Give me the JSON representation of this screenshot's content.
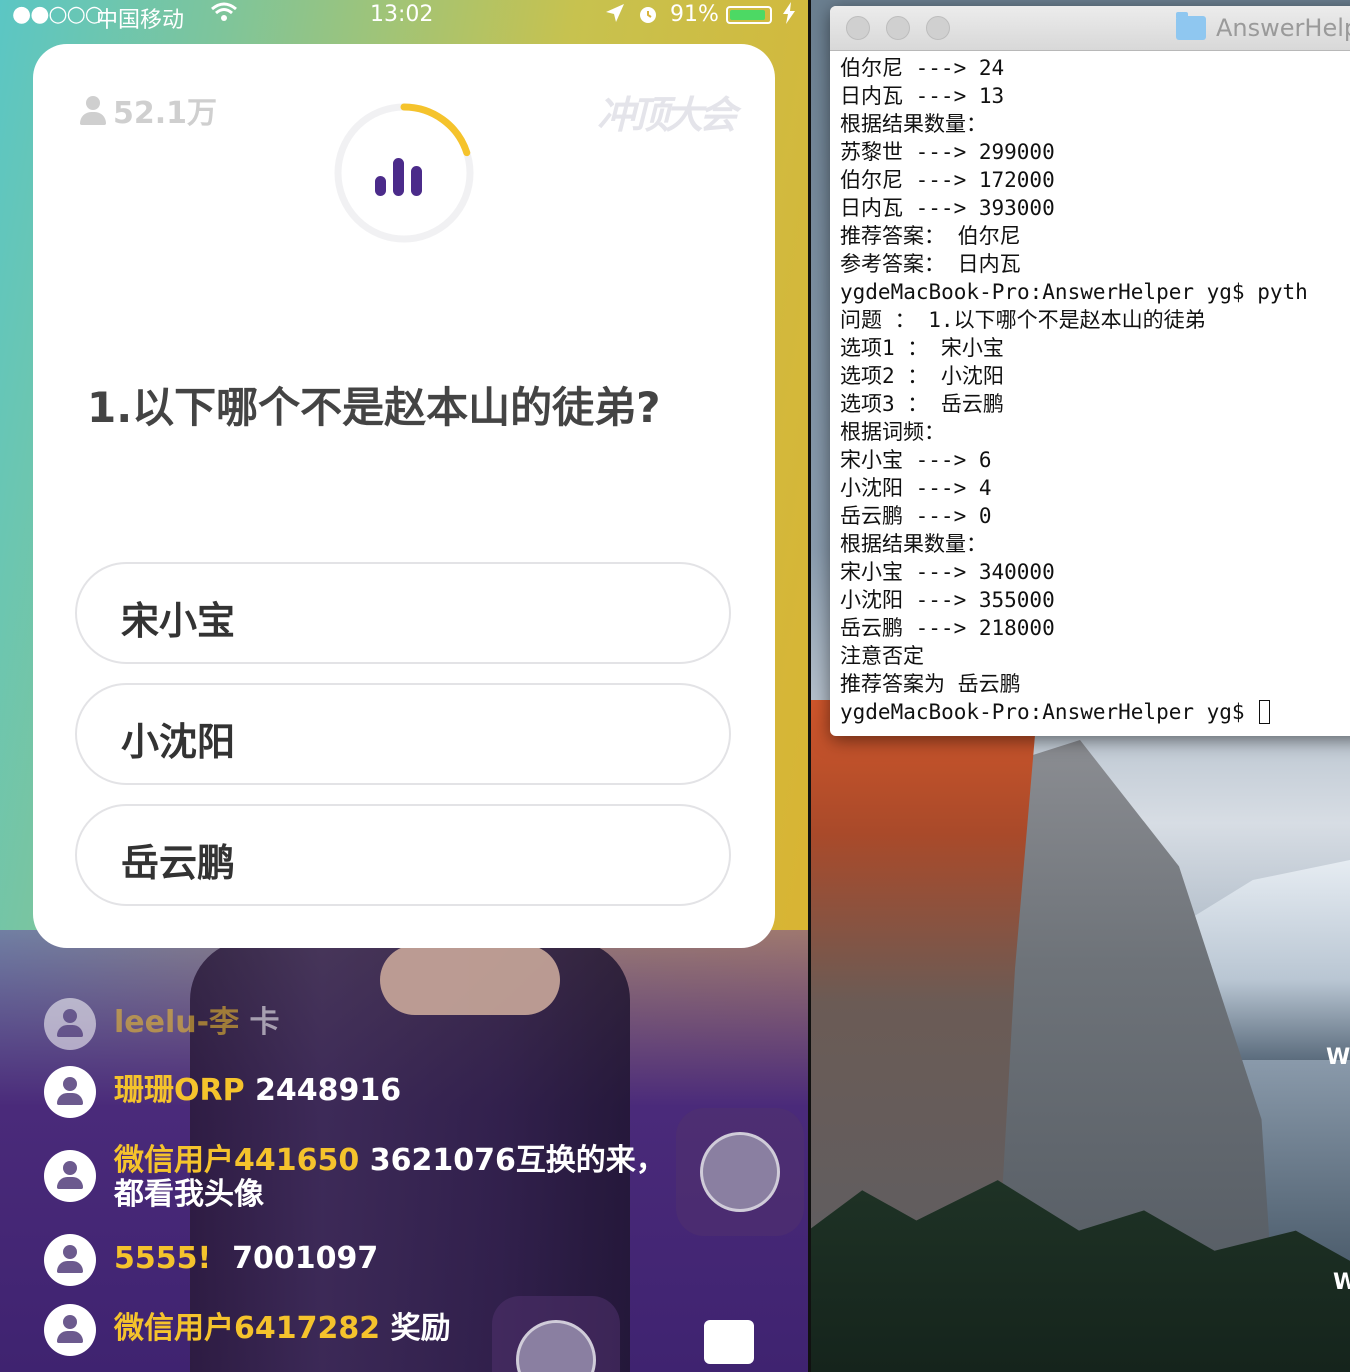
{
  "status_bar": {
    "signal": "●●○○○",
    "carrier": "中国移动",
    "wifi_icon": "wifi-icon",
    "time": "13:02",
    "location_icon": "location-arrow-icon",
    "alarm_icon": "alarm-icon",
    "battery_percent": "91%",
    "battery_level": 0.91,
    "charging_icon": "bolt-icon"
  },
  "quiz": {
    "viewer_count": "52.1万",
    "brand_logo": "冲顶大会",
    "timer_progress": 0.2,
    "question": "1.以下哪个不是赵本山的徒弟?",
    "options": [
      "宋小宝",
      "小沈阳",
      "岳云鹏"
    ]
  },
  "chat": [
    {
      "user": "leelu-李",
      "message": "卡"
    },
    {
      "user": "珊珊ORP",
      "message": " 2448916"
    },
    {
      "user": "微信用户441650",
      "message": " 3621076互换的来，都看我头像"
    },
    {
      "user": "5555!",
      "message": "  7001097"
    },
    {
      "user": "微信用户6417282",
      "message": " 奖励"
    }
  ],
  "terminal": {
    "title": "AnswerHelper",
    "lines": [
      "伯尔尼 ---> 24",
      "日内瓦 ---> 13",
      "根据结果数量：",
      "苏黎世 ---> 299000",
      "伯尔尼 ---> 172000",
      "日内瓦 ---> 393000",
      "推荐答案： 伯尔尼",
      "参考答案： 日内瓦",
      "ygdeMacBook-Pro:AnswerHelper yg$ pyth",
      "问题 ： 1.以下哪个不是赵本山的徒弟",
      "选项1 ： 宋小宝",
      "选项2 ： 小沈阳",
      "选项3 ： 岳云鹏",
      "根据词频：",
      "宋小宝 ---> 6",
      "小沈阳 ---> 4",
      "岳云鹏 ---> 0",
      "根据结果数量：",
      "宋小宝 ---> 340000",
      "小沈阳 ---> 355000",
      "岳云鹏 ---> 218000",
      "注意否定",
      "推荐答案为 岳云鹏"
    ],
    "prompt": "ygdeMacBook-Pro:AnswerHelper yg$ "
  },
  "wallpaper_marks": [
    "W",
    "W"
  ]
}
